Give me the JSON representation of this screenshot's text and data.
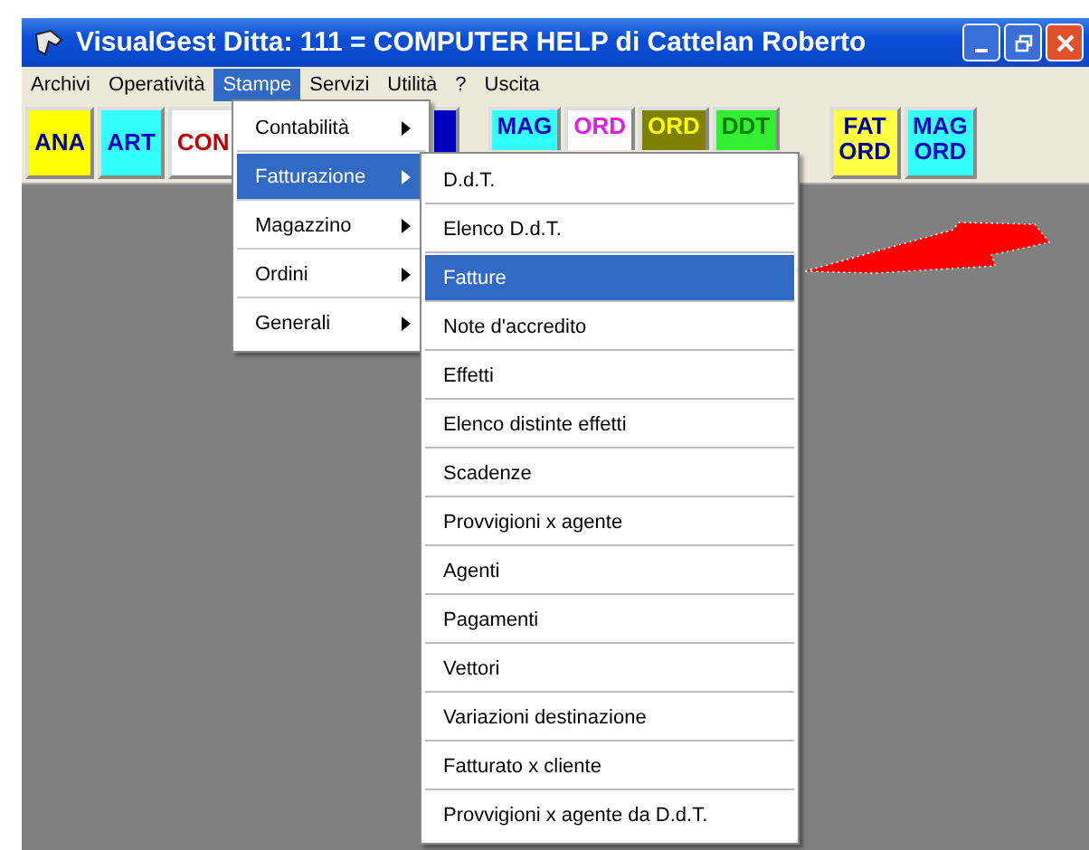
{
  "window": {
    "title": "VisualGest  Ditta: 111 = COMPUTER HELP di Cattelan Roberto"
  },
  "menu_bar": [
    {
      "label": "Archivi",
      "selected": false
    },
    {
      "label": "Operatività",
      "selected": false
    },
    {
      "label": "Stampe",
      "selected": true
    },
    {
      "label": "Servizi",
      "selected": false
    },
    {
      "label": "Utilità",
      "selected": false
    },
    {
      "label": "?",
      "selected": false
    },
    {
      "label": "Uscita",
      "selected": false
    }
  ],
  "toolbar": [
    {
      "kind": "text",
      "lines": [
        "ANA"
      ],
      "color": "#ffff00"
    },
    {
      "kind": "text",
      "lines": [
        "ART"
      ],
      "color": "#33ffff"
    },
    {
      "kind": "text",
      "lines": [
        "CON"
      ],
      "color": "#ffffff"
    },
    {
      "kind": "covered",
      "color": "#0000c0"
    },
    {
      "kind": "text",
      "lines": [
        "MAG"
      ],
      "color": "#33ffff"
    },
    {
      "kind": "text",
      "lines": [
        "ORD"
      ],
      "color": "#fcfcfc"
    },
    {
      "kind": "text",
      "lines": [
        "ORD"
      ],
      "color": "#808000"
    },
    {
      "kind": "text",
      "lines": [
        "DDT"
      ],
      "color": "#33ee33"
    },
    {
      "kind": "text",
      "lines": [
        "FAT",
        "ORD"
      ],
      "color": "#ffff44"
    },
    {
      "kind": "text",
      "lines": [
        "MAG",
        "ORD"
      ],
      "color": "#33ffff"
    }
  ],
  "dropdown": {
    "items": [
      {
        "label": "Contabilità",
        "selected": false,
        "submenu": true
      },
      {
        "label": "Fatturazione",
        "selected": true,
        "submenu": true
      },
      {
        "label": "Magazzino",
        "selected": false,
        "submenu": true
      },
      {
        "label": "Ordini",
        "selected": false,
        "submenu": true
      },
      {
        "label": "Generali",
        "selected": false,
        "submenu": true
      }
    ]
  },
  "submenu": {
    "items": [
      {
        "label": "D.d.T.",
        "selected": false
      },
      {
        "label": "Elenco D.d.T.",
        "selected": false
      },
      {
        "label": "Fatture",
        "selected": true
      },
      {
        "label": "Note d'accredito",
        "selected": false
      },
      {
        "label": "Effetti",
        "selected": false
      },
      {
        "label": "Elenco distinte effetti",
        "selected": false
      },
      {
        "label": "Scadenze",
        "selected": false
      },
      {
        "label": "Provvigioni x agente",
        "selected": false
      },
      {
        "label": "Agenti",
        "selected": false
      },
      {
        "label": "Pagamenti",
        "selected": false
      },
      {
        "label": "Vettori",
        "selected": false
      },
      {
        "label": "Variazioni destinazione",
        "selected": false
      },
      {
        "label": "Fatturato x cliente",
        "selected": false
      },
      {
        "label": "Provvigioni x agente da D.d.T.",
        "selected": false
      }
    ]
  }
}
